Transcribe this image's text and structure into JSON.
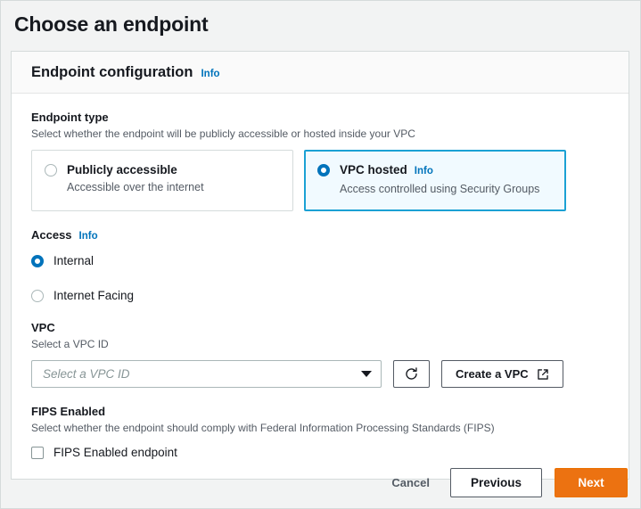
{
  "page": {
    "title": "Choose an endpoint"
  },
  "card": {
    "header_title": "Endpoint configuration",
    "header_info": "Info"
  },
  "endpoint_type": {
    "label": "Endpoint type",
    "description": "Select whether the endpoint will be publicly accessible or hosted inside your VPC",
    "options": [
      {
        "title": "Publicly accessible",
        "description": "Accessible over the internet",
        "selected": false,
        "info": ""
      },
      {
        "title": "VPC hosted",
        "description": "Access controlled using Security Groups",
        "selected": true,
        "info": "Info"
      }
    ]
  },
  "access": {
    "label": "Access",
    "info": "Info",
    "options": [
      {
        "label": "Internal",
        "selected": true
      },
      {
        "label": "Internet Facing",
        "selected": false
      }
    ]
  },
  "vpc": {
    "label": "VPC",
    "description": "Select a VPC ID",
    "placeholder": "Select a VPC ID",
    "value": "",
    "refresh_icon": "refresh-icon",
    "create_button": "Create a VPC",
    "external_link_icon": "external-link-icon"
  },
  "fips": {
    "label": "FIPS Enabled",
    "description": "Select whether the endpoint should comply with Federal Information Processing Standards (FIPS)",
    "checkbox_label": "FIPS Enabled endpoint",
    "checked": false
  },
  "footer": {
    "cancel": "Cancel",
    "previous": "Previous",
    "next": "Next"
  },
  "colors": {
    "accent_blue": "#0073bb",
    "selected_border": "#1ba1d4",
    "selected_bg": "#f1faff",
    "primary_orange": "#ec7211",
    "page_bg": "#f2f3f3"
  }
}
